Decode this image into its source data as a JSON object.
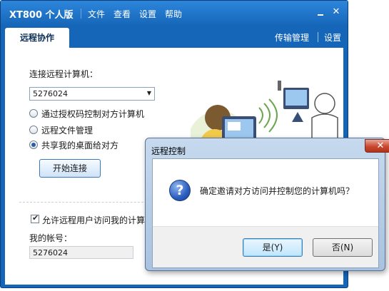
{
  "app": {
    "title": "XT800 个人版",
    "menu": [
      "文件",
      "查看",
      "设置",
      "帮助"
    ],
    "window_controls": {
      "minimize": "",
      "close": "✕"
    }
  },
  "tabs": {
    "active": "远程协作",
    "links": [
      "传输管理",
      "设置"
    ]
  },
  "connect_panel": {
    "label": "连接远程计算机：",
    "computer_id": "5276024",
    "options": [
      {
        "label": "通过授权码控制对方计算机",
        "selected": false
      },
      {
        "label": "远程文件管理",
        "selected": false
      },
      {
        "label": "共享我的桌面给对方",
        "selected": true
      }
    ],
    "start_button": "开始连接"
  },
  "allow_panel": {
    "checkbox_label": "允许远程用户访问我的计算机",
    "checked": true,
    "account_label": "我的帐号：",
    "account_value": "5276024"
  },
  "dialog": {
    "title": "远程控制",
    "close": "✕",
    "icon": "question-icon",
    "message": "确定邀请对方访问并控制您的计算机吗？",
    "yes_button": "是(Y)",
    "no_button": "否(N)"
  },
  "colors": {
    "window_blue": "#1565b8",
    "dialog_frame": "#b7cde6",
    "close_red": "#c8492e",
    "question_icon_blue": "#2b5fbf"
  }
}
